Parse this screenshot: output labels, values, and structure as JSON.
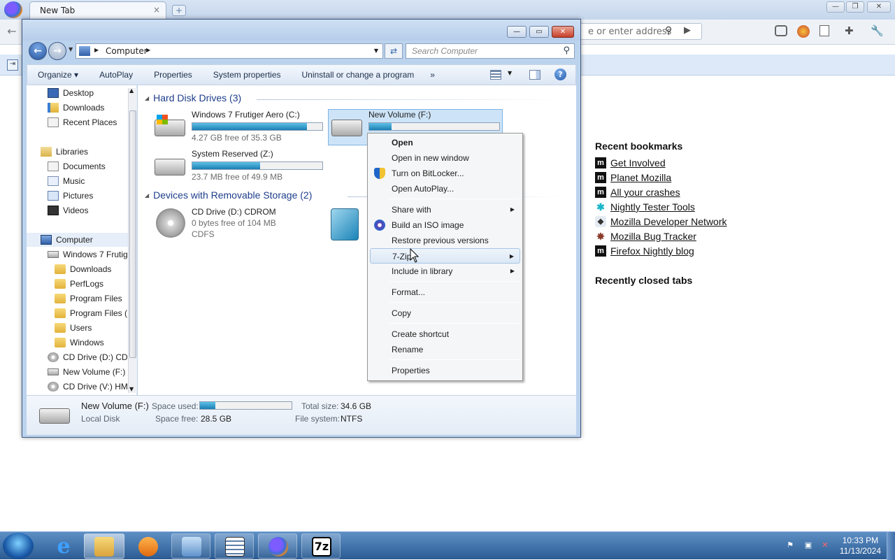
{
  "browser": {
    "tab_title": "New Tab",
    "tab_close": "×",
    "new_tab": "+",
    "url_placeholder": "e or enter address",
    "new_tab_page": {
      "recent_bookmarks_heading": "Recent bookmarks",
      "bookmarks": [
        {
          "label": "Get Involved",
          "icon": "mozilla-m-icon"
        },
        {
          "label": "Planet Mozilla",
          "icon": "mozilla-m-icon"
        },
        {
          "label": "All your crashes",
          "icon": "mozilla-m-icon"
        },
        {
          "label": "Nightly Tester Tools",
          "icon": "nightly-tools-icon"
        },
        {
          "label": "Mozilla Developer Network",
          "icon": "mdn-icon"
        },
        {
          "label": "Mozilla Bug Tracker",
          "icon": "bugzilla-icon"
        },
        {
          "label": "Firefox Nightly blog",
          "icon": "mozilla-m-icon"
        }
      ],
      "recently_closed_heading": "Recently closed tabs"
    }
  },
  "explorer": {
    "address": {
      "location": "Computer"
    },
    "search_placeholder": "Search Computer",
    "toolbar": {
      "organize": "Organize ▾",
      "autoplay": "AutoPlay",
      "properties": "Properties",
      "system_properties": "System properties",
      "uninstall": "Uninstall or change a program",
      "more": "»"
    },
    "nav": {
      "favorites": [
        "Desktop",
        "Downloads",
        "Recent Places"
      ],
      "libraries_label": "Libraries",
      "libraries": [
        "Documents",
        "Music",
        "Pictures",
        "Videos"
      ],
      "computer_label": "Computer",
      "computer_items": [
        "Windows 7 Frutig",
        "Downloads",
        "PerfLogs",
        "Program Files",
        "Program Files (",
        "Users",
        "Windows",
        "CD Drive (D:) CD",
        "New Volume (F:)",
        "CD Drive (V:) HM"
      ]
    },
    "groups": {
      "hdd": "Hard Disk Drives (3)",
      "removable": "Devices with Removable Storage (2)"
    },
    "drives": [
      {
        "name": "Windows 7 Frutiger Aero (C:)",
        "free": "4.27 GB free of 35.3 GB",
        "used_fraction": 0.88
      },
      {
        "name": "New Volume (F:)",
        "free": "",
        "used_fraction": 0.17
      },
      {
        "name": "System Reserved (Z:)",
        "free": "23.7 MB free of 49.9 MB",
        "used_fraction": 0.52
      },
      {
        "name": "CD Drive (D:) CDROM",
        "free": "0 bytes free of 104 MB",
        "fs": "CDFS"
      }
    ],
    "details": {
      "name": "New Volume (F:)",
      "type": "Local Disk",
      "space_used_label": "Space used:",
      "space_used_fraction": 0.17,
      "space_free_label": "Space free:",
      "space_free": "28.5 GB",
      "total_size_label": "Total size:",
      "total_size": "34.6 GB",
      "file_system_label": "File system:",
      "file_system": "NTFS"
    }
  },
  "context_menu": {
    "open": "Open",
    "open_new_window": "Open in new window",
    "bitlocker": "Turn on BitLocker...",
    "autoplay": "Open AutoPlay...",
    "share_with": "Share with",
    "build_iso": "Build an ISO image",
    "restore": "Restore previous versions",
    "seven_zip": "7-Zip",
    "include_library": "Include in library",
    "format": "Format...",
    "copy": "Copy",
    "create_shortcut": "Create shortcut",
    "rename": "Rename",
    "properties": "Properties"
  },
  "taskbar": {
    "time": "10:33 PM",
    "date": "11/13/2024",
    "apps": [
      "internet-explorer-icon",
      "file-explorer-icon",
      "media-player-icon",
      "control-panel-icon",
      "notepad-icon",
      "firefox-icon",
      "7zip-icon"
    ],
    "seven_zip_label": "7z"
  }
}
